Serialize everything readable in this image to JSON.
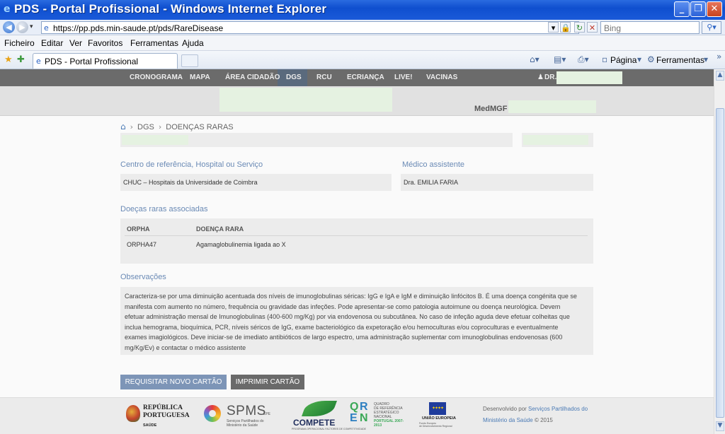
{
  "window": {
    "title": "PDS - Portal Profissional - Windows Internet Explorer",
    "url": "https://pp.pds.min-saude.pt/pds/RareDisease",
    "search_placeholder": "Bing"
  },
  "menu": [
    "Ficheiro",
    "Editar",
    "Ver",
    "Favoritos",
    "Ferramentas",
    "Ajuda"
  ],
  "tab": {
    "label": "PDS - Portal Profissional"
  },
  "commandbar": {
    "page_label": "Página",
    "tools_label": "Ferramentas"
  },
  "topnav": {
    "items": [
      "CRONOGRAMA",
      "MAPA",
      "ÁREA CIDADÃO",
      "DGS",
      "RCU",
      "ECRIANÇA",
      "LIVE!",
      "VACINAS"
    ],
    "active": "DGS",
    "user_label": "DR."
  },
  "subheader": {
    "med_label": "MedMGF"
  },
  "breadcrumb": {
    "items": [
      "DGS",
      "DOENÇAS RARAS"
    ]
  },
  "centro": {
    "title": "Centro de referência, Hospital ou Serviço",
    "value": "CHUC – Hospitais da Universidade de Coimbra"
  },
  "medico": {
    "title": "Médico assistente",
    "value": "Dra. EMILIA FARIA"
  },
  "doencas": {
    "title": "Doeças raras associadas",
    "columns": [
      "ORPHA",
      "DOENÇA RARA"
    ],
    "rows": [
      {
        "orpha": "ORPHA47",
        "doenca": "Agamaglobulinemia ligada ao X"
      }
    ]
  },
  "observacoes": {
    "title": "Observações",
    "text": "Caracteriza-se por uma diminuição acentuada dos níveis de imunoglobulinas séricas: IgG e IgA e IgM e diminuição linfócitos B. É uma doença congénita que se manifesta com aumento no número, frequência ou gravidade das infeções. Pode apresentar-se como patologia autoimune ou doença neurológica. Devem efetuar administração mensal de Imunoglobulinas (400-600 mg/Kg) por via endovenosa ou subcutânea. No caso de infeção aguda deve efetuar colheitas que inclua hemograma, bioquímica, PCR, níveis séricos de IgG, exame bacteriológico da expetoração e/ou hemoculturas e/ou coproculturas e eventualmente exames imagiológicos. Deve iniciar-se de imediato antibióticos de largo espectro, uma administração suplementar com imunoglobulinas endovenosas (600 mg/Kg/Ev) e contactar o médico assistente"
  },
  "buttons": {
    "requisitar": "REQUISITAR NOVO CARTÃO",
    "imprimir": "IMPRIMIR CARTÃO"
  },
  "footer": {
    "republica_line1": "REPÚBLICA",
    "republica_line2": "PORTUGUESA",
    "republica_sub": "SAÚDE",
    "spms": "SPMS",
    "spms_epe": "EPE",
    "spms_desc1": "Serviços Partilhados do",
    "spms_desc2": "Ministério da Saúde",
    "compete": "COMPETE",
    "compete_sub": "PROGRAMA OPERACIONAL FACTORES DE COMPETITIVIDADE",
    "qren_line1": "QUADRO",
    "qren_line2": "DE REFERÊNCIA",
    "qren_line3": "ESTRATÉGICO",
    "qren_line4": "NACIONAL",
    "qren_line5": "PORTUGAL 2007-2013",
    "ue_label": "UNIÃO EUROPEIA",
    "ue_fund1": "Fundo Europeu",
    "ue_fund2": "de Desenvolvimento Regional",
    "credits_prefix": "Desenvolvido por",
    "credits_link": "Serviços Partilhados do Ministério da Saúde",
    "credits_suffix": "© 2015"
  }
}
